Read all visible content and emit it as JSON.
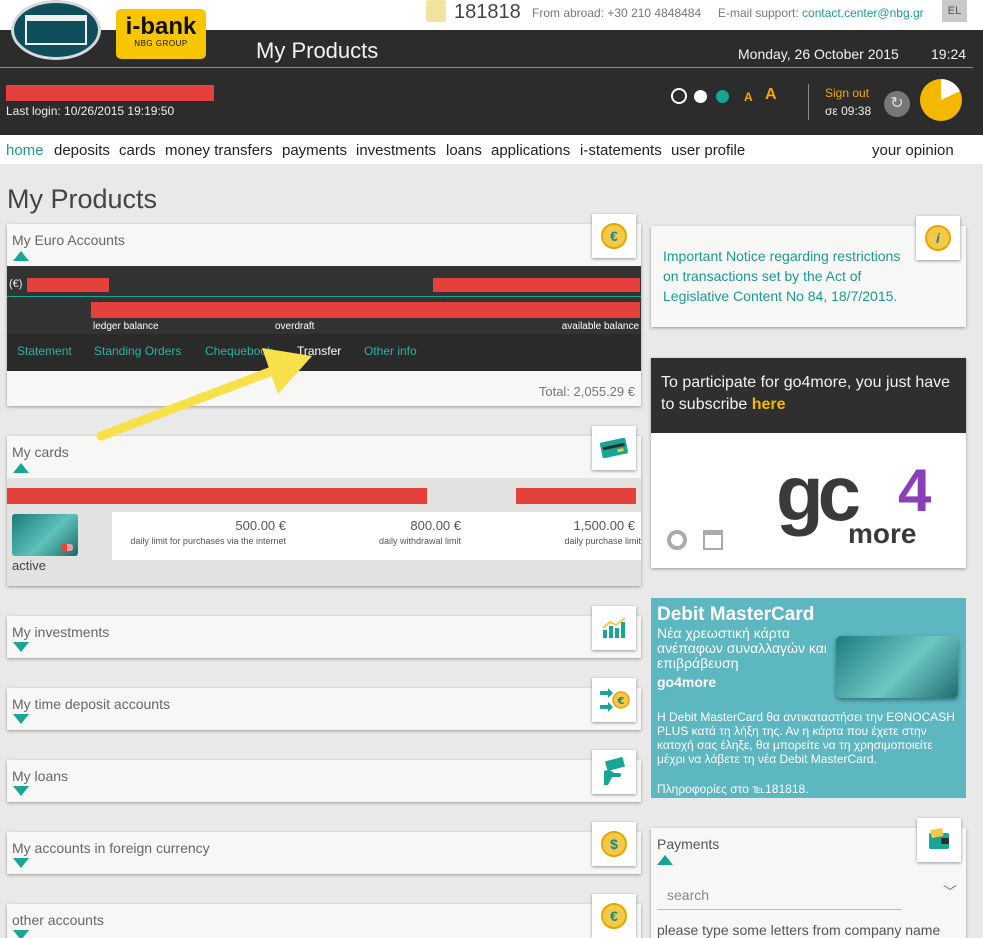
{
  "header": {
    "brand_top": "i-bank",
    "brand_sub": "NBG GROUP",
    "phone": "181818",
    "abroad_label": "From abroad:",
    "abroad_phone": "+30 210 4848484",
    "email_label": "E-mail support:",
    "email": "contact.center@nbg.gr",
    "language": "EL",
    "page_title": "My Products",
    "date": "Monday, 26 October 2015",
    "time": "19:24",
    "last_login": "Last login: 10/26/2015 19:19:50",
    "font_small": "A",
    "font_large": "A",
    "sign_out": "Sign out",
    "session_expiry": "σε 09:38",
    "session_remaining_fraction": 0.82
  },
  "nav": {
    "items": [
      "home",
      "deposits",
      "cards",
      "money transfers",
      "payments",
      "investments",
      "loans",
      "applications",
      "i-statements",
      "user profile"
    ],
    "opinion": "your opinion"
  },
  "main": {
    "title": "My Products",
    "euro_accounts": {
      "title": "My Euro Accounts",
      "currency": "(€)",
      "labels": [
        "ledger balance",
        "overdraft",
        "available balance"
      ],
      "links": [
        "Statement",
        "Standing Orders",
        "Chequebook",
        "Transfer",
        "Other info"
      ],
      "total": "Total: 2,055.29 €"
    },
    "cards": {
      "title": "My cards",
      "status": "active",
      "limits": [
        {
          "value": "500.00 €",
          "label": "daily limit for purchases via the internet"
        },
        {
          "value": "800.00 €",
          "label": "daily withdrawal limit"
        },
        {
          "value": "1,500.00 €",
          "label": "daily purchase limit"
        }
      ]
    },
    "collapsed_sections": [
      "My investments",
      "My time deposit accounts",
      "My loans",
      "My accounts in foreign currency",
      "other accounts"
    ]
  },
  "sidebar": {
    "notice": "Important Notice regarding restrictions on transactions set by the Act of Legislative Content No 84, 18/7/2015.",
    "go4more_text": "To participate for go4more, you just have to subscribe",
    "go4more_link": "here",
    "go4more_logo_main": "gc",
    "go4more_logo_four": "4",
    "go4more_logo_more": "more",
    "promo": {
      "title": "Debit MasterCard",
      "subtitle": "Νέα χρεωστική κάρτα ανέπαφων συναλλαγών και επιβράβευση",
      "brand": "go4more",
      "body": "Η Debit MasterCard θα αντικαταστήσει την ΕΘΝΟCASH PLUS κατά τη λήξη της. Αν η κάρτα που έχετε στην κατοχή σας έληξε, θα μπορείτε να τη χρησιμοποιείτε μέχρι να λάβετε τη νέα Debit MasterCard.",
      "info": "Πληροφορίες στο ℡181818."
    },
    "payments": {
      "title": "Payments",
      "search_placeholder": "search",
      "hint": "please type some letters from company name"
    }
  },
  "colors": {
    "accent": "#17a594",
    "header_bg": "#2c2c2c",
    "highlight": "#f5b800",
    "redaction": "#e5403b"
  }
}
